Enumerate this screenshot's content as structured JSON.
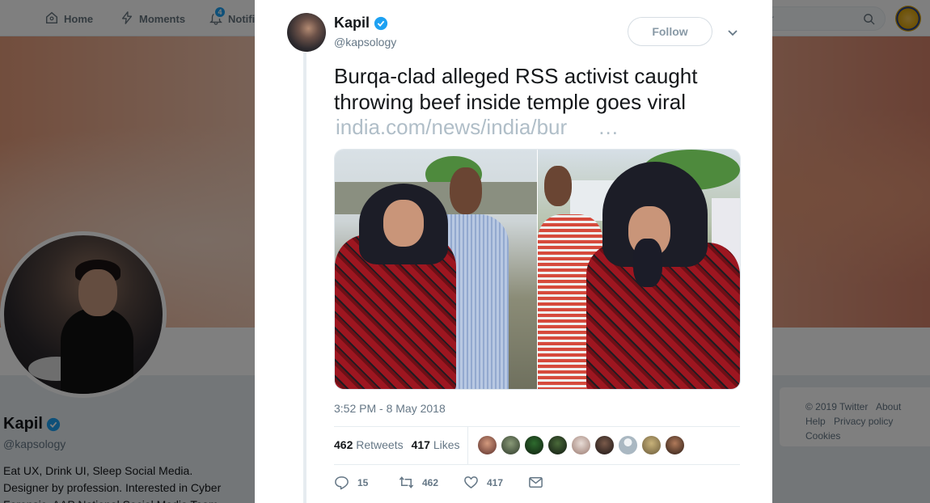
{
  "nav": {
    "home": "Home",
    "moments": "Moments",
    "notifications": "Notifi",
    "notification_count": "4",
    "search_placeholder": "r"
  },
  "profile": {
    "name": "Kapil",
    "handle": "@kapsology",
    "bio": "Eat UX, Drink UI, Sleep Social Media. Designer by profession. Interested in Cyber Forensic. AAP National Social Media Team."
  },
  "footer": {
    "copyright": "© 2019 Twitter",
    "about": "About",
    "help": "Help",
    "privacy": "Privacy policy",
    "cookies": "Cookies"
  },
  "tweet": {
    "author_name": "Kapil",
    "author_handle": "@kapsology",
    "follow_label": "Follow",
    "text": "Burqa-clad alleged RSS activist caught throwing beef inside temple goes viral",
    "link": "india.com/news/india/bur",
    "link_ellipsis": "…",
    "timestamp": "3:52 PM - 8 May 2018",
    "retweets_count": "462",
    "retweets_label": "Retweets",
    "likes_count": "417",
    "likes_label": "Likes",
    "reply_count": "15",
    "retweet_count_action": "462",
    "like_count_action": "417"
  },
  "colors": {
    "twitter_blue": "#1da1f2",
    "text_dark": "#14171a",
    "text_gray": "#657786",
    "link_gray": "#b0bec8"
  },
  "icons": [
    "home-icon",
    "lightning-icon",
    "bell-icon",
    "search-icon",
    "verified-badge-icon",
    "chevron-down-icon",
    "reply-icon",
    "retweet-icon",
    "heart-icon",
    "message-icon"
  ]
}
